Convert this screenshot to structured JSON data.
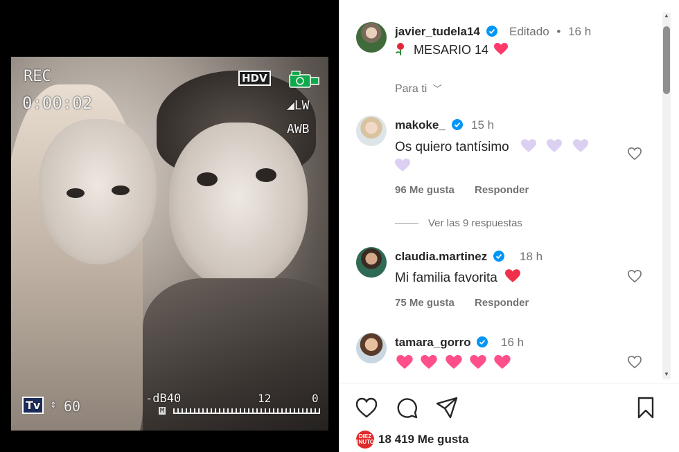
{
  "media": {
    "hud": {
      "rec": "REC",
      "time": "0:00:02",
      "hdv": "HDV",
      "lw": "LW",
      "awb": "AWB",
      "tv": "Tv",
      "shutter": "60",
      "db": "-dB40",
      "mid_tick": "12",
      "end_tick": "0",
      "meter_label": "M"
    }
  },
  "post": {
    "author": "javier_tudela14",
    "edited": "Editado",
    "separator": "•",
    "time": "16 h",
    "caption": "MESARIO 14",
    "for_you": "Para ti"
  },
  "comments": [
    {
      "username": "makoke_",
      "time": "15 h",
      "text": "Os quiero tantísimo",
      "likes": "96 Me gusta",
      "reply": "Responder"
    },
    {
      "username": "claudia.martinez",
      "time": "18 h",
      "text": "Mi familia favorita",
      "likes": "75 Me gusta",
      "reply": "Responder"
    },
    {
      "username": "tamara_gorro",
      "time": "16 h",
      "text": ""
    }
  ],
  "view_replies": "Ver las 9 respuestas",
  "footer": {
    "likes_avatar_text": "DIEZ MINUTOS",
    "likes_count": "18 419 Me gusta"
  },
  "colors": {
    "verified": "#0095f6",
    "heart": "#ff3040",
    "purple_heart": "#d9c8f0",
    "pink_heart": "#ff4f8b"
  }
}
